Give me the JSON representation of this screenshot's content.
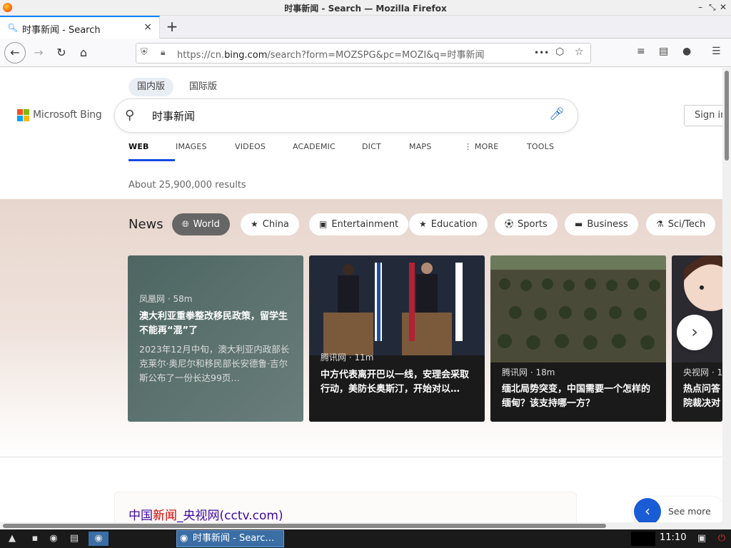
{
  "window": {
    "title": "时事新闻 - Search — Mozilla Firefox",
    "controls": [
      "–",
      "⤡",
      "✕"
    ]
  },
  "tab": {
    "label": "时事新闻 - Search",
    "close": "×",
    "new_tab": "+"
  },
  "nav": {
    "url_prefix": "https://cn.",
    "url_domain": "bing.com",
    "url_rest": "/search?form=MOZSPG&pc=MOZI&q=时事新闻",
    "more": "•••"
  },
  "bing": {
    "scope_tabs": [
      "国内版",
      "国际版"
    ],
    "logo_text": "Microsoft Bing",
    "logo_colors": [
      "#f25022",
      "#7fba00",
      "#00a4ef",
      "#ffb900"
    ],
    "query": "时事新闻",
    "sign_in": "Sign in",
    "tabs": [
      "WEB",
      "IMAGES",
      "VIDEOS",
      "ACADEMIC",
      "DICT",
      "MAPS",
      "MORE",
      "TOOLS"
    ],
    "results_count": "About 25,900,000 results",
    "news": {
      "heading": "News",
      "chips": [
        "World",
        "China",
        "Entertainment",
        "Education",
        "Sports",
        "Business",
        "Sci/Tech"
      ],
      "cards": [
        {
          "source": "凤凰网 · 58m",
          "headline": "澳大利亚重拳整改移民政策，留学生不能再“混”了",
          "desc": "2023年12月中旬，澳大利亚内政部长克莱尔·奥尼尔和移民部长安德鲁·吉尔斯公布了一份长达99页…"
        },
        {
          "source": "腾讯网 · 11m",
          "headline": "中方代表离开巴以一线，安理会采取行动，美防长奥斯汀，开始对以…"
        },
        {
          "source": "腾讯网 · 18m",
          "headline": "缅北局势突变，中国需要一个怎样的缅甸？该支持哪一方？"
        },
        {
          "source": "央视网 · 1",
          "headline": "热点问答院裁决对"
        }
      ]
    },
    "first_result": {
      "title_a": "中国",
      "title_em": "新闻",
      "title_b": "_央视网(cctv.com)"
    },
    "see_more": "See more"
  },
  "taskbar": {
    "window_label": "时事新闻 - Searc…",
    "clock": "11:10"
  }
}
